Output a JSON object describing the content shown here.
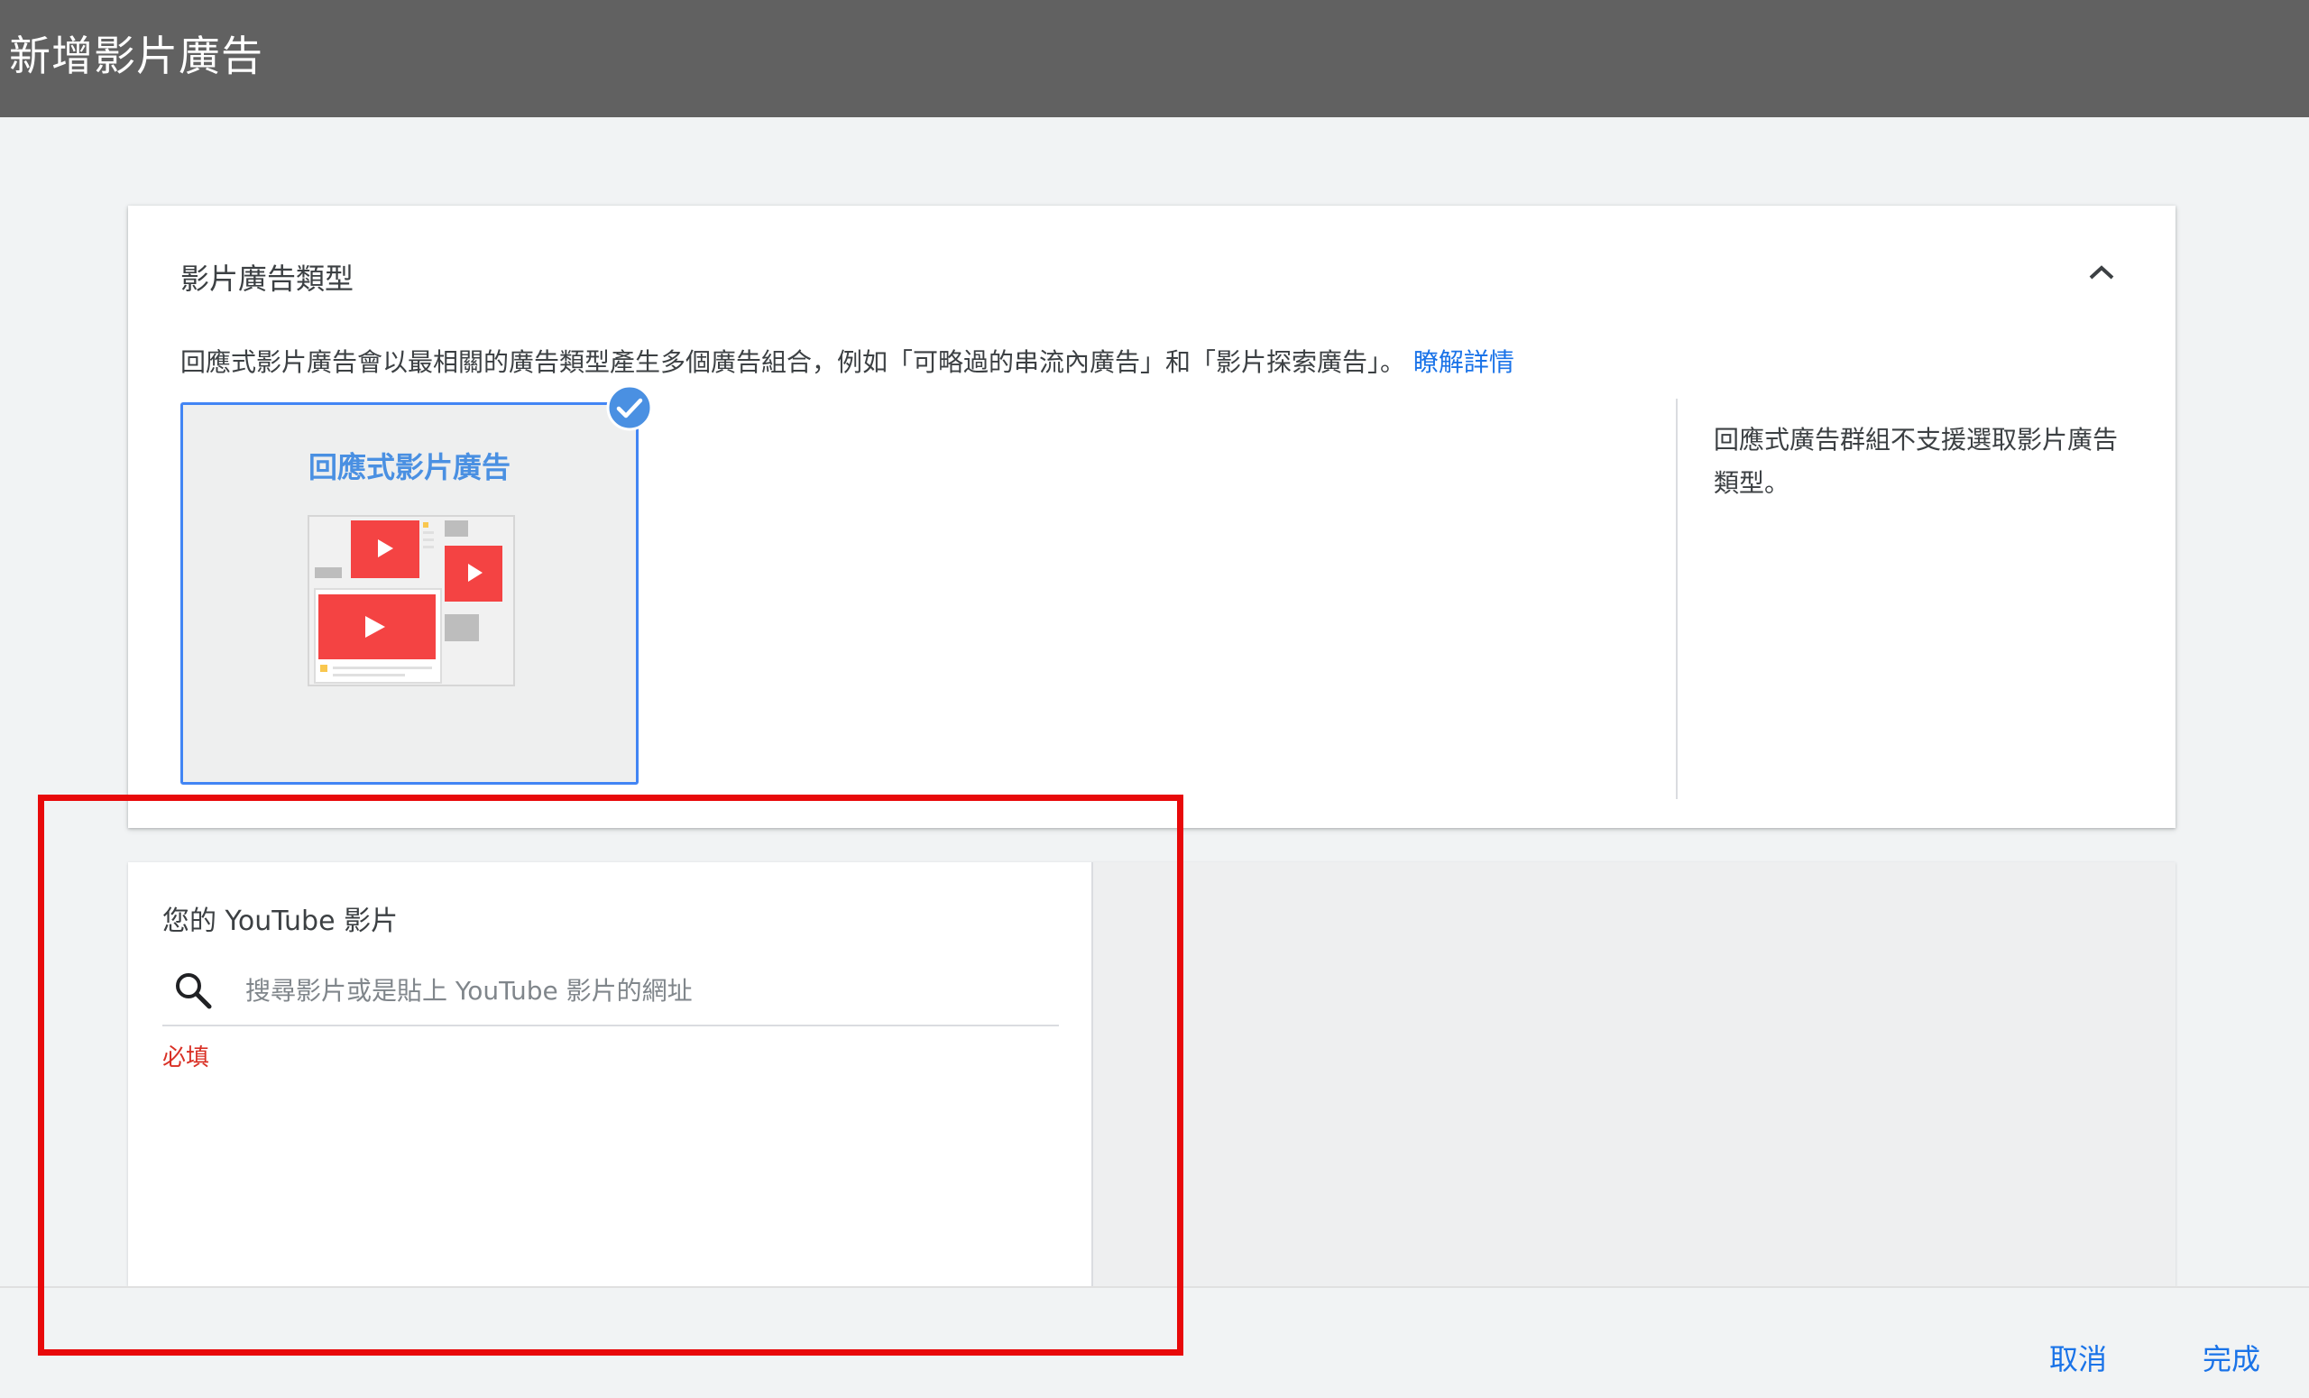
{
  "header": {
    "title": "新增影片廣告"
  },
  "ad_type_section": {
    "title": "影片廣告類型",
    "description": "回應式影片廣告會以最相關的廣告類型產生多個廣告組合，例如「可略過的串流內廣告」和「影片探索廣告」。",
    "learn_more": "瞭解詳情",
    "option": {
      "label": "回應式影片廣告",
      "selected": true
    },
    "side_note": "回應式廣告群組不支援選取影片廣告類型。"
  },
  "video_section": {
    "title": "您的 YouTube 影片",
    "search": {
      "placeholder": "搜尋影片或是貼上 YouTube 影片的網址",
      "value": ""
    },
    "validation": "必填"
  },
  "footer": {
    "cancel": "取消",
    "done": "完成"
  },
  "colors": {
    "header_bg": "#616161",
    "accent_blue": "#1a73e8",
    "selected_border": "#4285f4",
    "error_red": "#d93025",
    "highlight_red": "#e8090a",
    "play_red": "#f44343"
  },
  "icons": [
    "chevron-up-icon",
    "check-circle-icon",
    "search-icon",
    "play-icon"
  ]
}
